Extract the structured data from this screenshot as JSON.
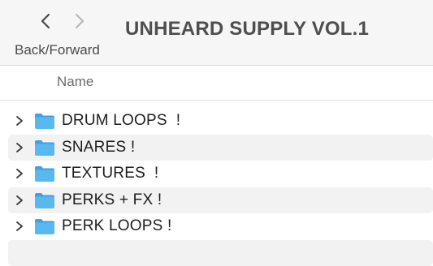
{
  "toolbar": {
    "back_icon": "chevron-left-icon",
    "forward_icon": "chevron-right-icon",
    "nav_label": "Back/Forward",
    "title": "UNHEARD SUPPLY VOL.1"
  },
  "columns": {
    "name": "Name"
  },
  "items": [
    {
      "label": "DRUM LOOPS  !",
      "icon": "folder-icon"
    },
    {
      "label": "SNARES !",
      "icon": "folder-icon"
    },
    {
      "label": "TEXTURES  !",
      "icon": "folder-icon"
    },
    {
      "label": "PERKS + FX !",
      "icon": "folder-icon"
    },
    {
      "label": "PERK LOOPS !",
      "icon": "folder-icon"
    }
  ],
  "colors": {
    "folder_blue": "#5ab8f0",
    "folder_tab": "#3fa3e3",
    "toolbar_bg": "#f6f6f6",
    "alt_row": "#f2f2f2"
  }
}
